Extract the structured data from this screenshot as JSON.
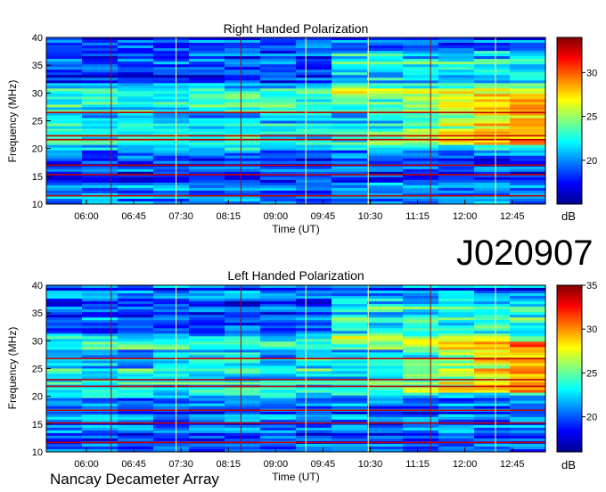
{
  "observation_id": "J020907",
  "footer_label": "Nancay Decameter Array",
  "chart_data": [
    {
      "type": "heatmap",
      "title": "Right Handed Polarization",
      "xlabel": "Time (UT)",
      "ylabel": "Frequency (MHz)",
      "x_ticks": [
        "06:00",
        "06:45",
        "07:30",
        "08:15",
        "09:00",
        "09:45",
        "10:30",
        "11:15",
        "12:00",
        "12:45"
      ],
      "y_ticks": [
        10,
        15,
        20,
        25,
        30,
        35,
        40
      ],
      "ylim": [
        10,
        40
      ],
      "colorbar": {
        "label": "dB",
        "ticks": [
          20,
          25,
          30
        ],
        "range": [
          15,
          34
        ]
      },
      "colormap": [
        "#00008f",
        "#0000ff",
        "#0080ff",
        "#00ffff",
        "#80ff80",
        "#ffff00",
        "#ff8000",
        "#ff0000",
        "#800000"
      ]
    },
    {
      "type": "heatmap",
      "title": "Left Handed Polarization",
      "xlabel": "Time (UT)",
      "ylabel": "Frequency (MHz)",
      "x_ticks": [
        "06:00",
        "06:45",
        "07:30",
        "08:15",
        "09:00",
        "09:45",
        "10:30",
        "11:15",
        "12:00",
        "12:45"
      ],
      "y_ticks": [
        10,
        15,
        20,
        25,
        30,
        35,
        40
      ],
      "ylim": [
        10,
        40
      ],
      "colorbar": {
        "label": "dB",
        "ticks": [
          20,
          25,
          30,
          35
        ],
        "range": [
          16,
          35
        ]
      },
      "colormap": [
        "#00008f",
        "#0000ff",
        "#0080ff",
        "#00ffff",
        "#80ff80",
        "#ffff00",
        "#ff8000",
        "#ff0000",
        "#800000"
      ]
    }
  ]
}
